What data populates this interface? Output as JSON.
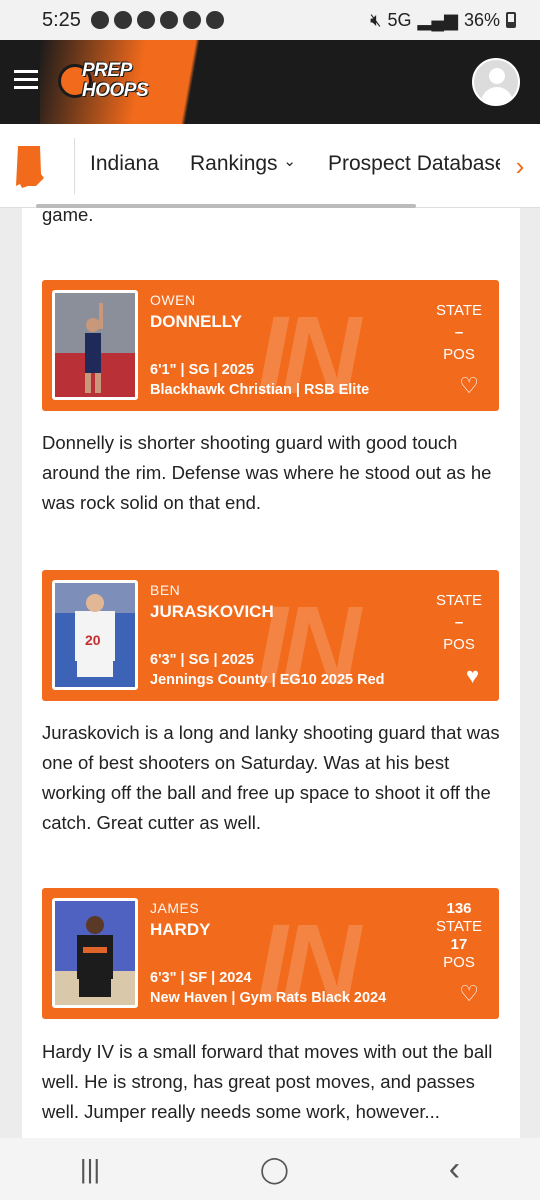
{
  "status": {
    "time": "5:25",
    "network": "5G",
    "battery": "36%"
  },
  "header": {
    "logo_line1": "PREP",
    "logo_line2": "HOOPS"
  },
  "subnav": {
    "items": [
      "Indiana",
      "Rankings",
      "Prospect Database"
    ],
    "rankings_caret": "⌄",
    "more_arrow": "›"
  },
  "content": {
    "intro_tail": "game.",
    "players": [
      {
        "first": "OWEN",
        "last": "DONNELLY",
        "meta": "6'1\"  |  SG  |  2025",
        "school": "Blackhawk Christian  |  RSB Elite",
        "rank_top": "",
        "rank_label": "STATE",
        "rank_value": "–",
        "pos_label": "POS",
        "favorite": false,
        "bio": "Donnelly is shorter shooting guard with good touch around the rim. Defense was where he stood out as he was rock solid on that end."
      },
      {
        "first": "BEN",
        "last": "JURASKOVICH",
        "meta": "6'3\"  |  SG  |  2025",
        "school": "Jennings County  |  EG10 2025 Red",
        "rank_top": "",
        "rank_label": "STATE",
        "rank_value": "–",
        "pos_label": "POS",
        "favorite": true,
        "bio": "Juraskovich is a long and lanky shooting guard that was one of best shooters on Saturday. Was at his best working off the ball and free up space to shoot it off the catch. Great cutter as well."
      },
      {
        "first": "JAMES",
        "last": "HARDY",
        "meta": "6'3\"  |  SF  |  2024",
        "school": "New Haven  |  Gym Rats Black 2024",
        "rank_top": "136",
        "rank_label": "STATE",
        "rank_value": "17",
        "pos_label": "POS",
        "favorite": false,
        "bio": "Hardy IV is a small forward that moves with out the ball well. He is strong, has great post moves, and passes well. Jumper really needs some work, however..."
      }
    ],
    "card_watermark": "IN"
  },
  "system_nav": {
    "recents": "|||",
    "home": "◯",
    "back": "‹"
  },
  "colors": {
    "brand_orange": "#f26a1b",
    "header_dark": "#1b1b1b"
  },
  "icons": [
    "menu-icon",
    "user-avatar-icon",
    "indiana-state-icon",
    "chevron-right-icon",
    "heart-icon"
  ]
}
